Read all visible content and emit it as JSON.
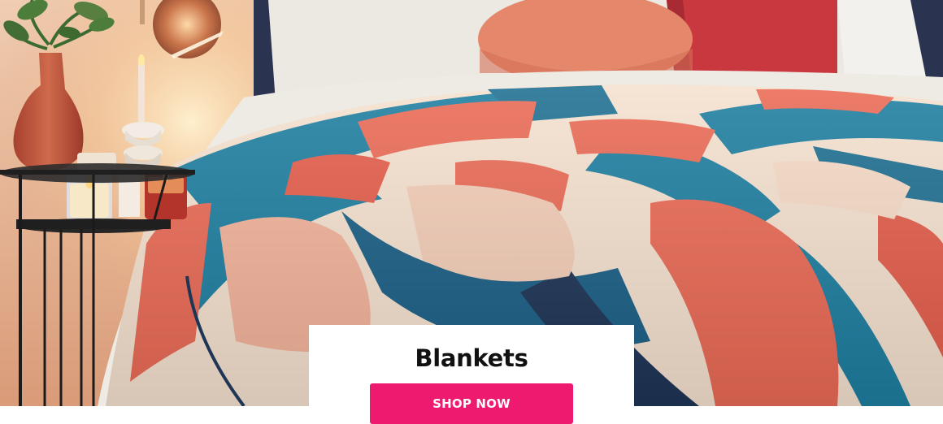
{
  "promo": {
    "title": "Blankets",
    "cta_label": "SHOP NOW",
    "cta_color": "#ee1a6f"
  },
  "scene": {
    "description_icon": "bedroom-photo",
    "palette": {
      "wall": "#e9bf9f",
      "coral": "#ea6a55",
      "teal": "#1d7ea0",
      "cream": "#f5e1cf",
      "navy": "#1e3556",
      "pillow_pink": "#e5876a",
      "pillow_red": "#c9373f",
      "sheet": "#eeeae4"
    }
  }
}
